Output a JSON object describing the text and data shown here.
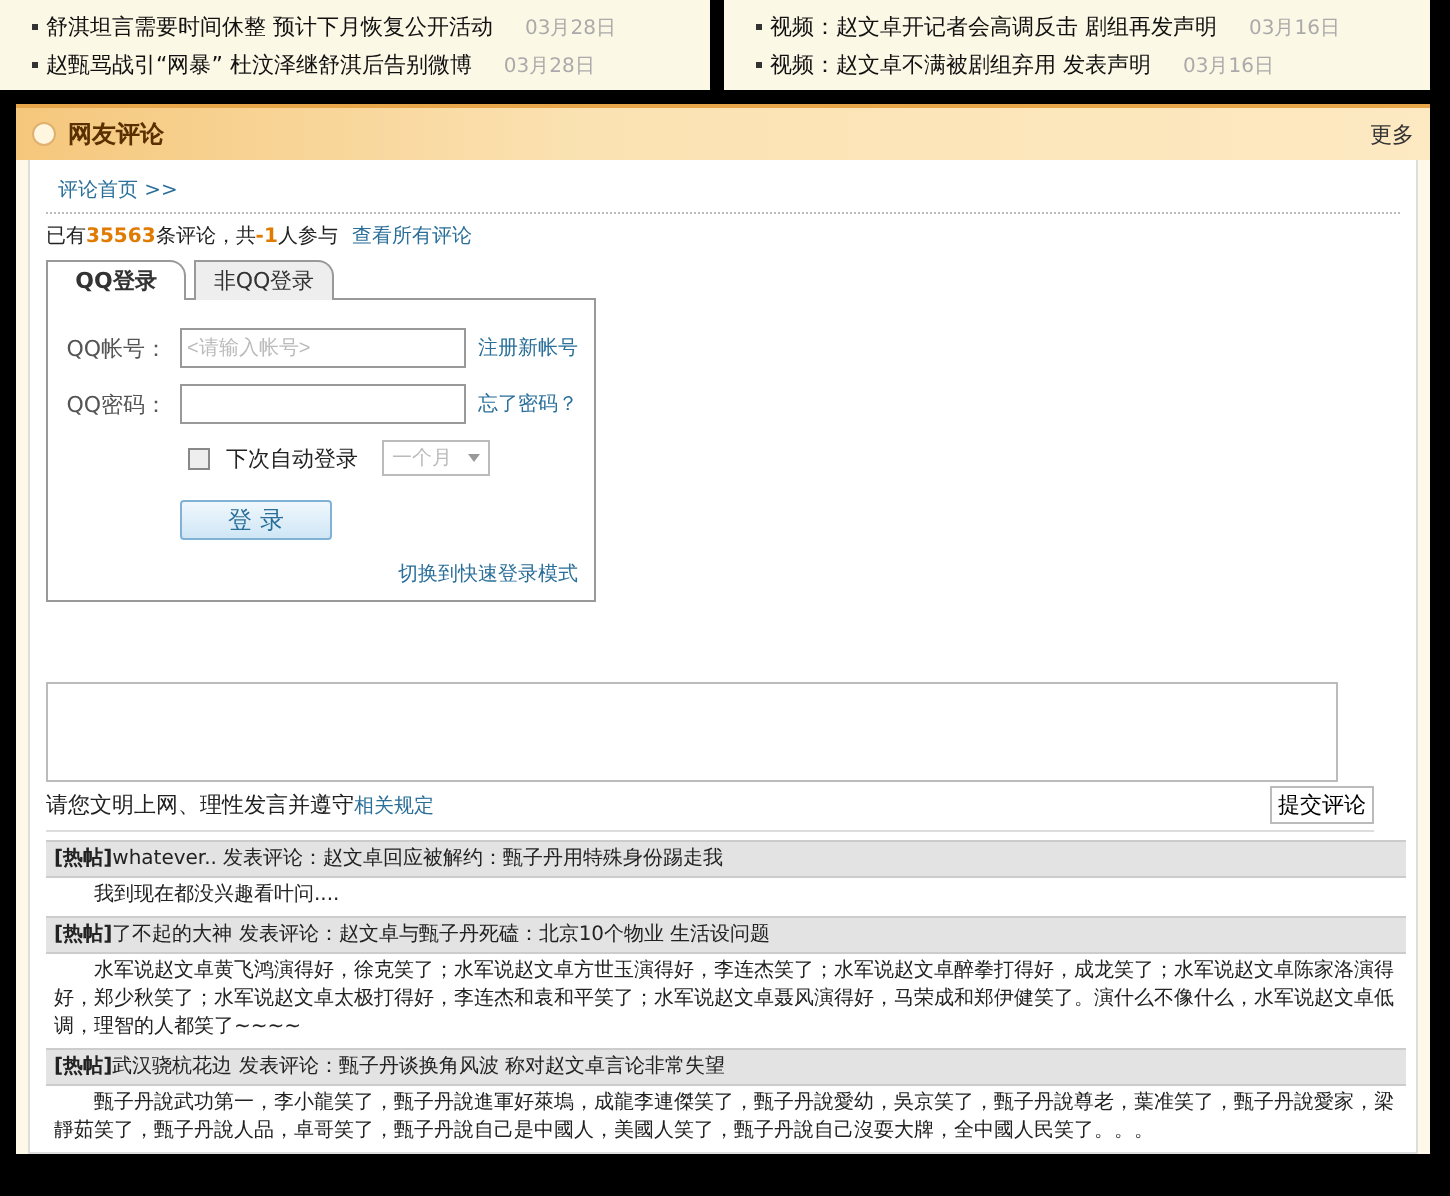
{
  "news": [
    {
      "items": [
        {
          "title": "舒淇坦言需要时间休整 预计下月恢复公开活动",
          "date": "03月28日"
        },
        {
          "title": "赵甄骂战引“网暴” 杜汶泽继舒淇后告别微博",
          "date": "03月28日"
        }
      ]
    },
    {
      "items": [
        {
          "title": "视频：赵文卓开记者会高调反击 剧组再发声明",
          "date": "03月16日"
        },
        {
          "title": "视频：赵文卓不满被剧组弃用 发表声明",
          "date": "03月16日"
        }
      ]
    }
  ],
  "section": {
    "title": "网友评论",
    "more": "更多"
  },
  "breadcrumb": "评论首页 >>",
  "stats": {
    "prefix": "已有",
    "count": "35563",
    "middle": "条评论，共",
    "people": "-1",
    "suffix": "人参与",
    "link": "查看所有评论"
  },
  "login": {
    "tabs": [
      {
        "label": "QQ登录",
        "selected": true
      },
      {
        "label": "非QQ登录",
        "selected": false
      }
    ],
    "fields": [
      {
        "label": "QQ帐号：",
        "placeholder": "<请输入帐号>",
        "link": "注册新帐号"
      },
      {
        "label": "QQ密码：",
        "link": "忘了密码？"
      }
    ],
    "remember": {
      "label": "下次自动登录",
      "checked": false
    },
    "duration": {
      "value": "一个月",
      "disabled": true
    },
    "button": "登 录",
    "switch_link": "切换到快速登录模式"
  },
  "comment_box": {
    "notice": "请您文明上网、理性发言并遵守",
    "notice_link": "相关规定",
    "submit": "提交评论"
  },
  "comments": [
    {
      "header": "**[热帖]**whatever..  发表评论：赵文卓回应被解约：甄子丹用特殊身份踢走我",
      "body": "我到现在都没兴趣看叶问...."
    },
    {
      "header": "**[热帖]**了不起的大神 发表评论：赵文卓与甄子丹死磕：北京10个物业 生活设问题",
      "body": "水军说赵文卓黄飞鸿演得好，徐克笑了；水军说赵文卓方世玉演得好，李连杰笑了；水军说赵文卓醉拳打得好，成龙笑了；水军说赵文卓陈家洛演得好，郑少秋笑了；水军说赵文卓太极打得好，李连杰和袁和平笑了；水军说赵文卓聂风演得好，马荣成和郑伊健笑了。演什么不像什么，水军说赵文卓低调，理智的人都笑了~~~~"
    },
    {
      "header": "**[热帖]**武汉骁杭花边 发表评论：甄子丹谈换角风波 称对赵文卓言论非常失望",
      "body": "甄子丹說武功第一，李小龍笑了，甄子丹說進軍好萊塢，成龍李連傑笑了，甄子丹說愛幼，吳京笑了，甄子丹說尊老，葉准笑了，甄子丹說愛家，梁靜茹笑了，甄子丹說人品，卓哥笑了，甄子丹說自己是中國人，美國人笑了，甄子丹說自己沒耍大牌，全中國人民笑了。。。"
    }
  ]
}
